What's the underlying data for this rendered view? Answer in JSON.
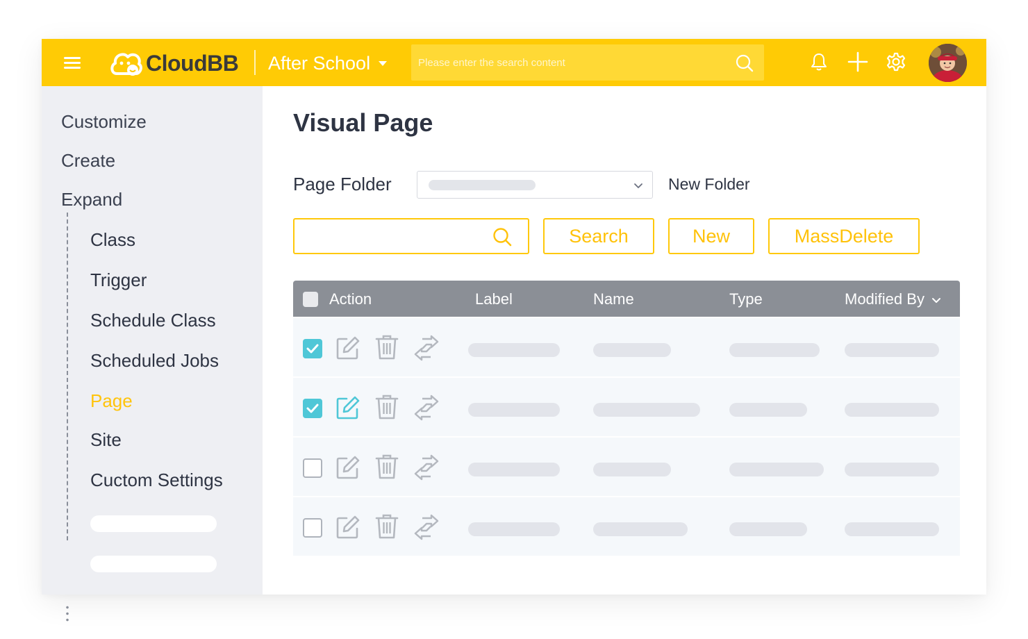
{
  "header": {
    "logo_text": "CloudBB",
    "app_name": "After School",
    "search_placeholder": "Please enter the search content",
    "icons": [
      "menu-icon",
      "bell-icon",
      "plus-icon",
      "gear-icon",
      "user-avatar"
    ]
  },
  "sidebar": {
    "top_items": [
      {
        "label": "Customize"
      },
      {
        "label": "Create"
      },
      {
        "label": "Expand"
      }
    ],
    "children": [
      {
        "label": "Class",
        "active": false
      },
      {
        "label": "Trigger",
        "active": false
      },
      {
        "label": "Schedule Class",
        "active": false
      },
      {
        "label": "Scheduled Jobs",
        "active": false
      },
      {
        "label": "Page",
        "active": true
      },
      {
        "label": "Site",
        "active": false
      },
      {
        "label": "Cuctom Settings",
        "active": false
      }
    ]
  },
  "main": {
    "title": "Visual Page",
    "folder_label": "Page Folder",
    "new_folder_label": "New Folder",
    "search_value": "",
    "buttons": {
      "search": "Search",
      "new": "New",
      "mass_delete": "MassDelete"
    }
  },
  "table": {
    "columns": [
      "Action",
      "Label",
      "Name",
      "Type",
      "Modified By"
    ],
    "rows": [
      {
        "checked": true,
        "edit_active": false
      },
      {
        "checked": true,
        "edit_active": true
      },
      {
        "checked": false,
        "edit_active": false
      },
      {
        "checked": false,
        "edit_active": false
      }
    ]
  },
  "colors": {
    "brand_yellow": "#ffcb05",
    "accent_teal": "#4fc7d7",
    "header_gray": "#8b8f96",
    "text_dark": "#2e3443"
  }
}
